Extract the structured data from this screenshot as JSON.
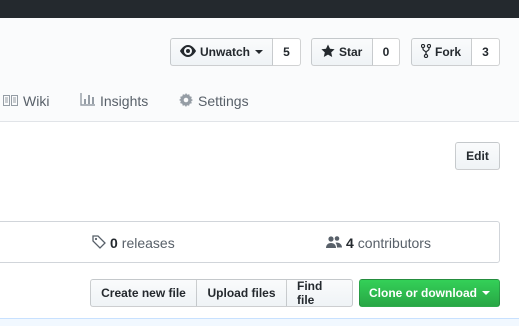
{
  "header": {
    "watch": {
      "label": "Unwatch",
      "count": "5",
      "icon": "eye-icon"
    },
    "star": {
      "label": "Star",
      "count": "0",
      "icon": "star-icon"
    },
    "fork": {
      "label": "Fork",
      "count": "3",
      "icon": "repo-forked-icon"
    }
  },
  "reponav": {
    "items": [
      {
        "label": "Wiki",
        "icon": "book-icon"
      },
      {
        "label": "Insights",
        "icon": "graph-icon"
      },
      {
        "label": "Settings",
        "icon": "gear-icon"
      }
    ]
  },
  "repo_meta": {
    "edit_label": "Edit"
  },
  "summary": {
    "releases": {
      "count": "0",
      "label": "releases",
      "icon": "tag-icon"
    },
    "contributors": {
      "count": "4",
      "label": "contributors",
      "icon": "organization-icon"
    }
  },
  "file_navigation": {
    "create_new_file": "Create new file",
    "upload_files": "Upload files",
    "find_file": "Find file",
    "clone_or_download": "Clone or download"
  },
  "colors": {
    "topbar": "#24292e",
    "clone_button": "#28a745",
    "muted_text": "#586069"
  }
}
